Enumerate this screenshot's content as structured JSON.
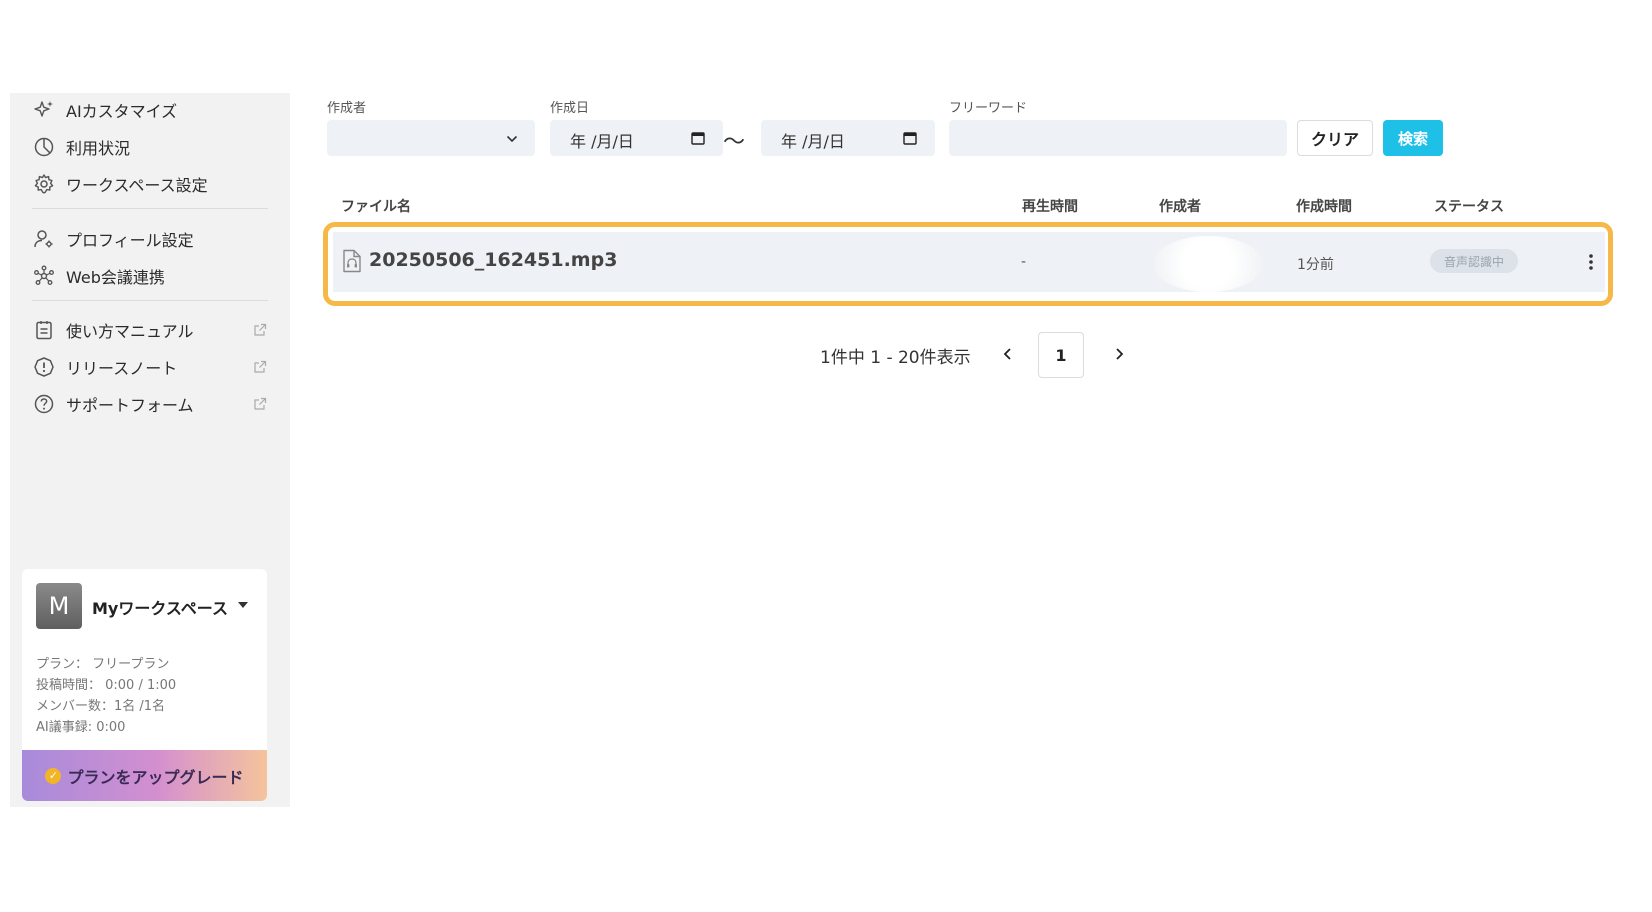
{
  "sidebar": {
    "items_top": [
      {
        "label": "AIカスタマイズ",
        "icon": "sparkle-icon"
      },
      {
        "label": "利用状況",
        "icon": "usage-chart-icon"
      },
      {
        "label": "ワークスペース設定",
        "icon": "gear-icon"
      }
    ],
    "items_mid": [
      {
        "label": "プロフィール設定",
        "icon": "user-settings-icon"
      },
      {
        "label": "Web会議連携",
        "icon": "network-icon"
      }
    ],
    "items_bottom": [
      {
        "label": "使い方マニュアル",
        "icon": "manual-icon"
      },
      {
        "label": "リリースノート",
        "icon": "alert-icon"
      },
      {
        "label": "サポートフォーム",
        "icon": "help-icon"
      }
    ],
    "workspace": {
      "avatar_letter": "M",
      "name": "Myワークスペース",
      "plan": "プラン： フリープラン",
      "post_time": "投稿時間： 0:00 / 1:00",
      "members": "メンバー数：1名 /1名",
      "ai_minutes": "AI議事録: 0:00",
      "upgrade_label": "プランをアップグレード"
    }
  },
  "filters": {
    "author_label": "作成者",
    "author_value": "",
    "date_label": "作成日",
    "date_from": "年 /月/日",
    "date_to": "年 /月/日",
    "range_sep": "〜",
    "freeword_label": "フリーワード",
    "freeword_value": "",
    "clear_label": "クリア",
    "search_label": "検索"
  },
  "table": {
    "headers": {
      "file_name": "ファイル名",
      "duration": "再生時間",
      "author": "作成者",
      "created": "作成時間",
      "status": "ステータス"
    },
    "rows": [
      {
        "file_name": "20250506_162451.mp3",
        "duration": "-",
        "author": "",
        "created": "1分前",
        "status": "音声認識中"
      }
    ]
  },
  "pagination": {
    "summary": "1件中 1 - 20件表示",
    "current_page": "1"
  },
  "colors": {
    "accent": "#1ec0e8",
    "highlight": "#f7b84a",
    "sidebar_bg": "#f2f2f3",
    "row_bg": "#eef1f5"
  }
}
